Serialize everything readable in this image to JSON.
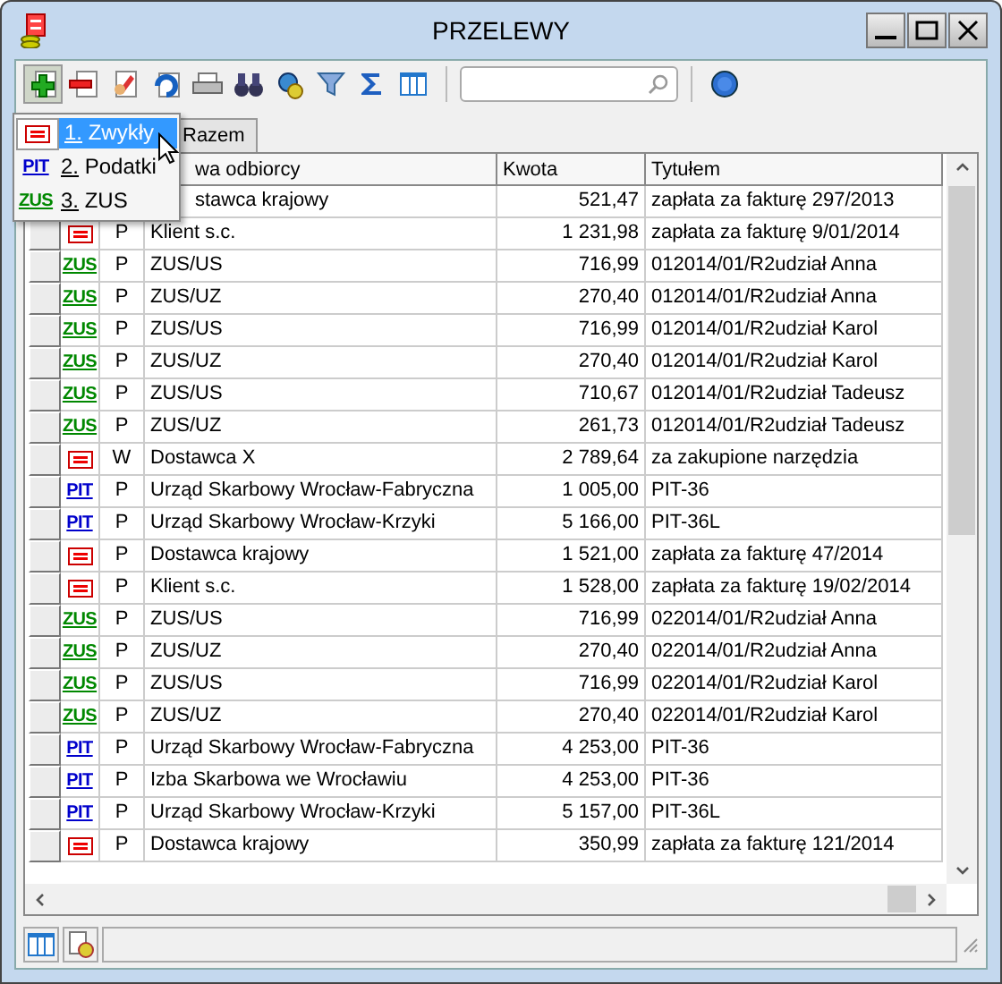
{
  "window": {
    "title": "PRZELEWY"
  },
  "new_menu": [
    {
      "kind": "plain",
      "label": "1. Zwykły",
      "selected": true
    },
    {
      "kind": "pit",
      "badge": "PIT",
      "label": "2. Podatki",
      "selected": false
    },
    {
      "kind": "zus",
      "badge": "ZUS",
      "label": "3. ZUS",
      "selected": false
    }
  ],
  "tabs": [
    {
      "label": "Razem",
      "selected": false
    }
  ],
  "table": {
    "columns": [
      "wa odbiorcy",
      "Kwota",
      "Tytułem"
    ],
    "rows": [
      {
        "name": "stawca krajowy",
        "amount": "521,47",
        "title": "zapłata za fakturę 297/2013"
      },
      {
        "kind": "plain",
        "status": "P",
        "name": "Klient s.c.",
        "amount": "1 231,98",
        "title": "zapłata za fakturę 9/01/2014"
      },
      {
        "kind": "zus",
        "badge": "ZUS",
        "status": "P",
        "name": "ZUS/US",
        "amount": "716,99",
        "title": "012014/01/R2udział Anna"
      },
      {
        "kind": "zus",
        "badge": "ZUS",
        "status": "P",
        "name": "ZUS/UZ",
        "amount": "270,40",
        "title": "012014/01/R2udział Anna"
      },
      {
        "kind": "zus",
        "badge": "ZUS",
        "status": "P",
        "name": "ZUS/US",
        "amount": "716,99",
        "title": "012014/01/R2udział Karol"
      },
      {
        "kind": "zus",
        "badge": "ZUS",
        "status": "P",
        "name": "ZUS/UZ",
        "amount": "270,40",
        "title": "012014/01/R2udział Karol"
      },
      {
        "kind": "zus",
        "badge": "ZUS",
        "status": "P",
        "name": "ZUS/US",
        "amount": "710,67",
        "title": "012014/01/R2udział Tadeusz"
      },
      {
        "kind": "zus",
        "badge": "ZUS",
        "status": "P",
        "name": "ZUS/UZ",
        "amount": "261,73",
        "title": "012014/01/R2udział Tadeusz"
      },
      {
        "kind": "plain",
        "status": "W",
        "name": "Dostawca X",
        "amount": "2 789,64",
        "title": "za zakupione narzędzia"
      },
      {
        "kind": "pit",
        "badge": "PIT",
        "status": "P",
        "name": "Urząd Skarbowy Wrocław-Fabryczna",
        "amount": "1 005,00",
        "title": "PIT-36"
      },
      {
        "kind": "pit",
        "badge": "PIT",
        "status": "P",
        "name": "Urząd Skarbowy Wrocław-Krzyki",
        "amount": "5 166,00",
        "title": "PIT-36L"
      },
      {
        "kind": "plain",
        "status": "P",
        "name": "Dostawca krajowy",
        "amount": "1 521,00",
        "title": "zapłata za fakturę 47/2014"
      },
      {
        "kind": "plain",
        "status": "P",
        "name": "Klient s.c.",
        "amount": "1 528,00",
        "title": "zapłata za fakturę 19/02/2014"
      },
      {
        "kind": "zus",
        "badge": "ZUS",
        "status": "P",
        "name": "ZUS/US",
        "amount": "716,99",
        "title": "022014/01/R2udział Anna"
      },
      {
        "kind": "zus",
        "badge": "ZUS",
        "status": "P",
        "name": "ZUS/UZ",
        "amount": "270,40",
        "title": "022014/01/R2udział Anna"
      },
      {
        "kind": "zus",
        "badge": "ZUS",
        "status": "P",
        "name": "ZUS/US",
        "amount": "716,99",
        "title": "022014/01/R2udział Karol"
      },
      {
        "kind": "zus",
        "badge": "ZUS",
        "status": "P",
        "name": "ZUS/UZ",
        "amount": "270,40",
        "title": "022014/01/R2udział Karol"
      },
      {
        "kind": "pit",
        "badge": "PIT",
        "status": "P",
        "name": "Urząd Skarbowy Wrocław-Fabryczna",
        "amount": "4 253,00",
        "title": "PIT-36"
      },
      {
        "kind": "pit",
        "badge": "PIT",
        "status": "P",
        "name": "Izba Skarbowa we Wrocławiu",
        "amount": "4 253,00",
        "title": "PIT-36"
      },
      {
        "kind": "pit",
        "badge": "PIT",
        "status": "P",
        "name": "Urząd Skarbowy Wrocław-Krzyki",
        "amount": "5 157,00",
        "title": "PIT-36L"
      },
      {
        "kind": "plain",
        "status": "P",
        "name": "Dostawca krajowy",
        "amount": "350,99",
        "title": "zapłata za fakturę 121/2014"
      }
    ]
  }
}
